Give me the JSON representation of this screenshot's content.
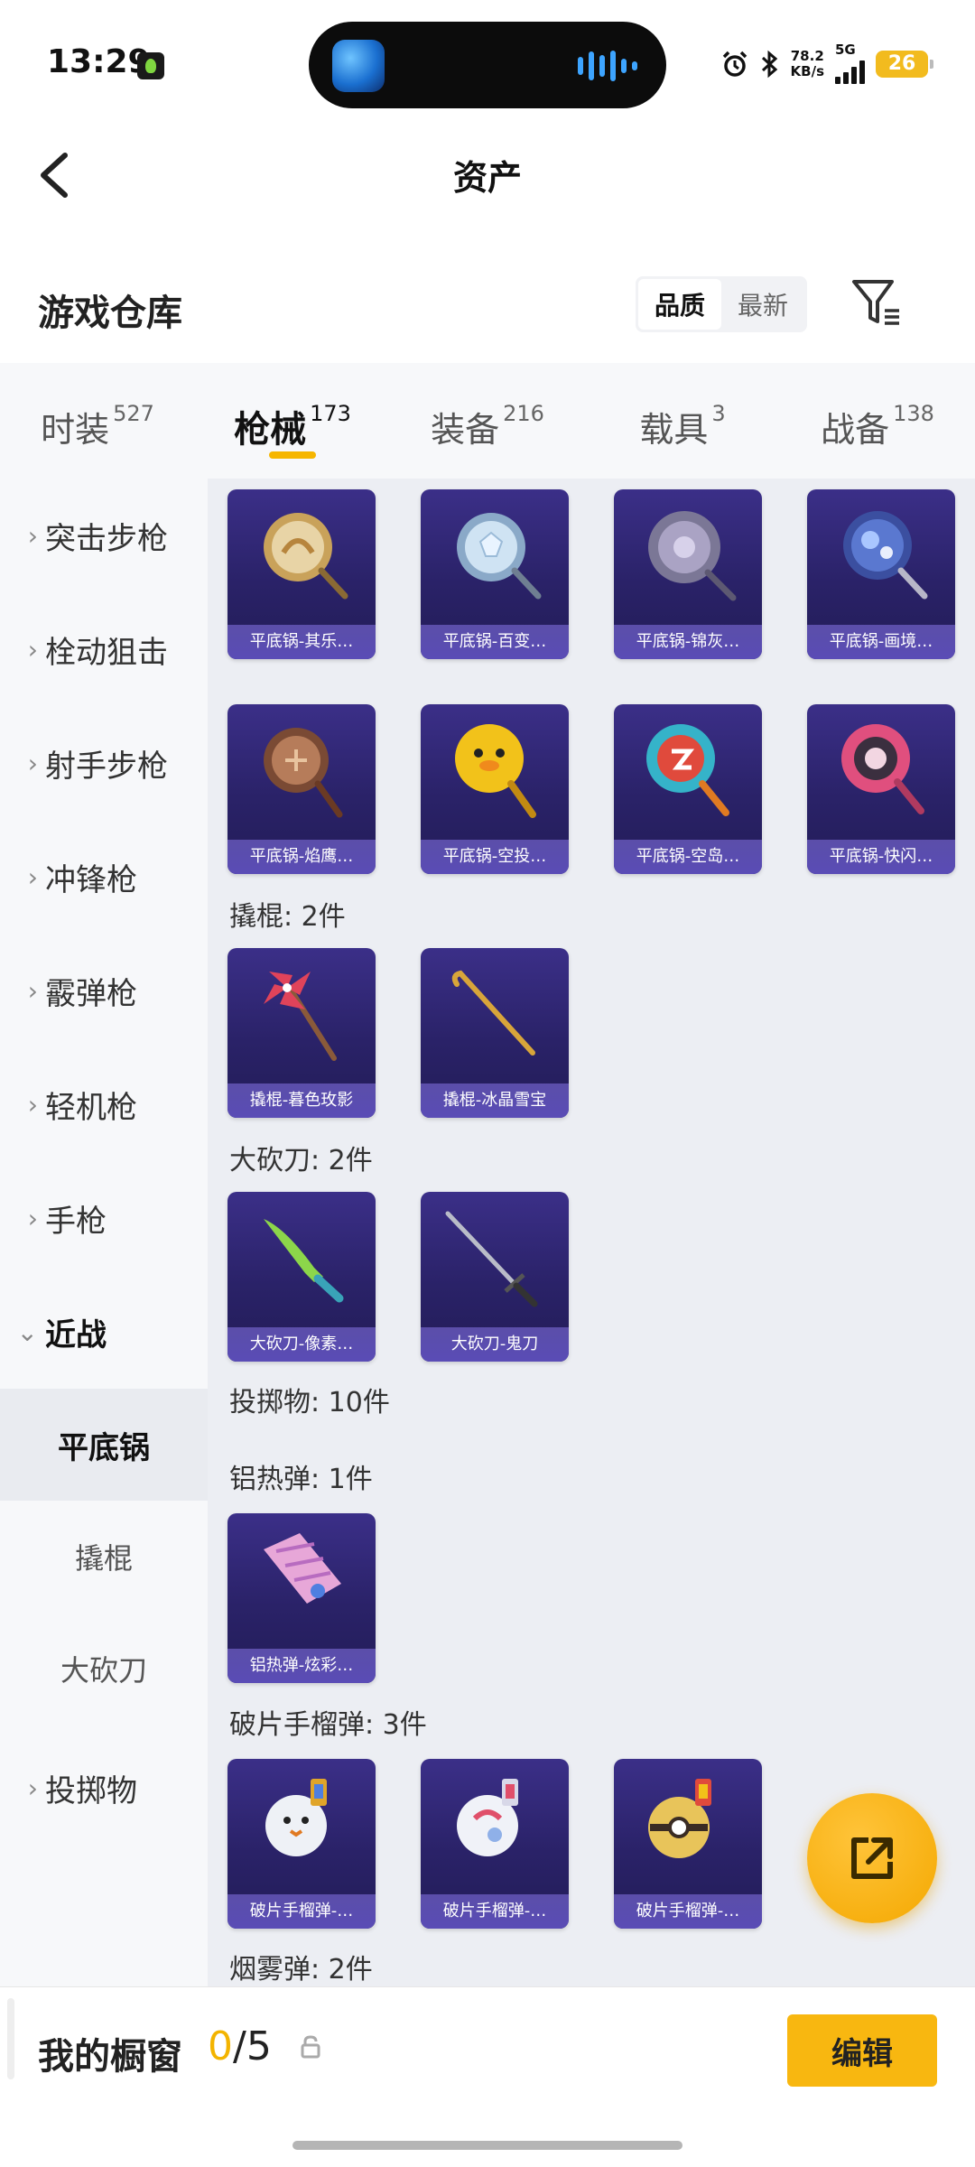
{
  "status_bar": {
    "time": "13:29",
    "speed_value": "78.2",
    "speed_unit": "KB/s",
    "network": "5G",
    "battery": "26"
  },
  "header": {
    "title": "资产"
  },
  "section": {
    "title": "游戏仓库",
    "sort_options": [
      "品质",
      "最新"
    ],
    "active_sort": "品质"
  },
  "tabs": [
    {
      "label": "时装",
      "count": "527"
    },
    {
      "label": "枪械",
      "count": "173",
      "active": true
    },
    {
      "label": "装备",
      "count": "216"
    },
    {
      "label": "载具",
      "count": "3"
    },
    {
      "label": "战备",
      "count": "138"
    }
  ],
  "sidebar": {
    "items": [
      {
        "label": "突击步枪"
      },
      {
        "label": "栓动狙击"
      },
      {
        "label": "射手步枪"
      },
      {
        "label": "冲锋枪"
      },
      {
        "label": "霰弹枪"
      },
      {
        "label": "轻机枪"
      },
      {
        "label": "手枪"
      },
      {
        "label": "近战",
        "expanded": true
      },
      {
        "label": "投掷物"
      }
    ],
    "sub_items": [
      {
        "label": "平底锅",
        "active": true
      },
      {
        "label": "撬棍"
      },
      {
        "label": "大砍刀"
      }
    ]
  },
  "content": {
    "pan_items": [
      {
        "name": "平底锅-其乐…",
        "icon": "pan-gold"
      },
      {
        "name": "平底锅-百变…",
        "icon": "pan-ice"
      },
      {
        "name": "平底锅-锦灰…",
        "icon": "pan-ornate-grey"
      },
      {
        "name": "平底锅-画境…",
        "icon": "pan-blue-art"
      },
      {
        "name": "平底锅-焰鹰…",
        "icon": "pan-bronze"
      },
      {
        "name": "平底锅-空投…",
        "icon": "pan-duck-yellow"
      },
      {
        "name": "平底锅-空岛…",
        "icon": "pan-colorful"
      },
      {
        "name": "平底锅-快闪…",
        "icon": "pan-pink"
      }
    ],
    "crowbar_group": {
      "label": "撬棍: 2件"
    },
    "crowbar_items": [
      {
        "name": "撬棍-暮色玫影",
        "icon": "crowbar-pinwheel"
      },
      {
        "name": "撬棍-冰晶雪宝",
        "icon": "crowbar-gold"
      }
    ],
    "machete_group": {
      "label": "大砍刀: 2件"
    },
    "machete_items": [
      {
        "name": "大砍刀-像素…",
        "icon": "machete-green"
      },
      {
        "name": "大砍刀-鬼刀",
        "icon": "machete-sword"
      }
    ],
    "throwable_group": {
      "label": "投掷物: 10件"
    },
    "thermite_group": {
      "label": "铝热弹: 1件"
    },
    "thermite_items": [
      {
        "name": "铝热弹-炫彩…",
        "icon": "thermite-pink"
      }
    ],
    "frag_group": {
      "label": "破片手榴弹: 3件"
    },
    "frag_items": [
      {
        "name": "破片手榴弹-…",
        "icon": "grenade-snowman"
      },
      {
        "name": "破片手榴弹-…",
        "icon": "grenade-white"
      },
      {
        "name": "破片手榴弹-…",
        "icon": "grenade-gold"
      }
    ],
    "smoke_group": {
      "label": "烟雾弹: 2件"
    }
  },
  "showcase": {
    "title": "我的橱窗",
    "current": "0",
    "total": "/5",
    "edit_label": "编辑"
  },
  "colors": {
    "accent": "#f6b600",
    "card_bg": "#2a2268",
    "card_label": "#5a4cb6"
  }
}
